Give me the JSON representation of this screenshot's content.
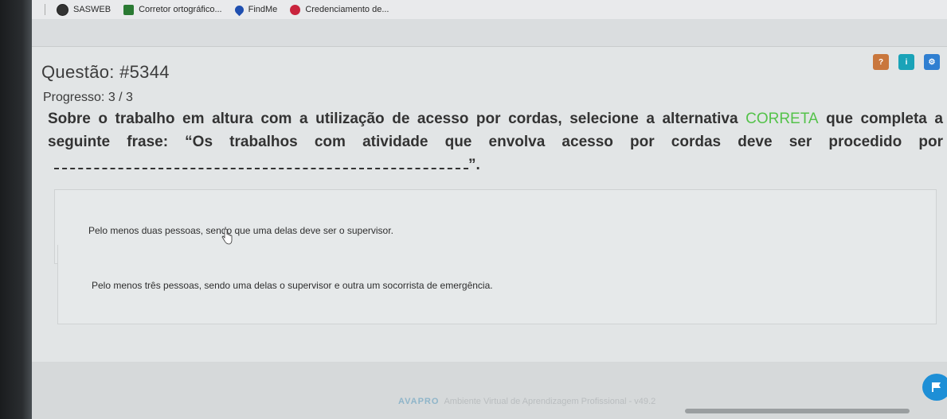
{
  "bookmarks": [
    {
      "label": "SASWEB",
      "icon": "globe-icon"
    },
    {
      "label": "Corretor ortográfico...",
      "icon": "document-icon"
    },
    {
      "label": "FindMe",
      "icon": "location-pin-icon"
    },
    {
      "label": "Credenciamento de...",
      "icon": "seal-icon"
    }
  ],
  "question": {
    "title": "Questão: #5344",
    "progress": "Progresso: 3 / 3",
    "text_before": "Sobre o trabalho em altura com a utilização de acesso por cordas, selecione a alternativa ",
    "highlight": "CORRETA",
    "text_after": " que completa a seguinte frase: “Os trabalhos com atividade que envolva acesso por cordas deve ser procedido por",
    "text_end": "”.",
    "highlight_color": "#54c24a"
  },
  "icons": {
    "help": "?",
    "info": "i",
    "settings": "⚙"
  },
  "options": [
    {
      "text": "Pelo menos duas pessoas, sendo que uma delas deve ser o supervisor."
    },
    {
      "text": "Pelo menos três pessoas, sendo uma delas o supervisor e outra um socorrista de emergência."
    }
  ],
  "footer": {
    "brand": "AVAPRO",
    "text": "Ambiente Virtual de Aprendizagem Profissional - v49.2"
  }
}
